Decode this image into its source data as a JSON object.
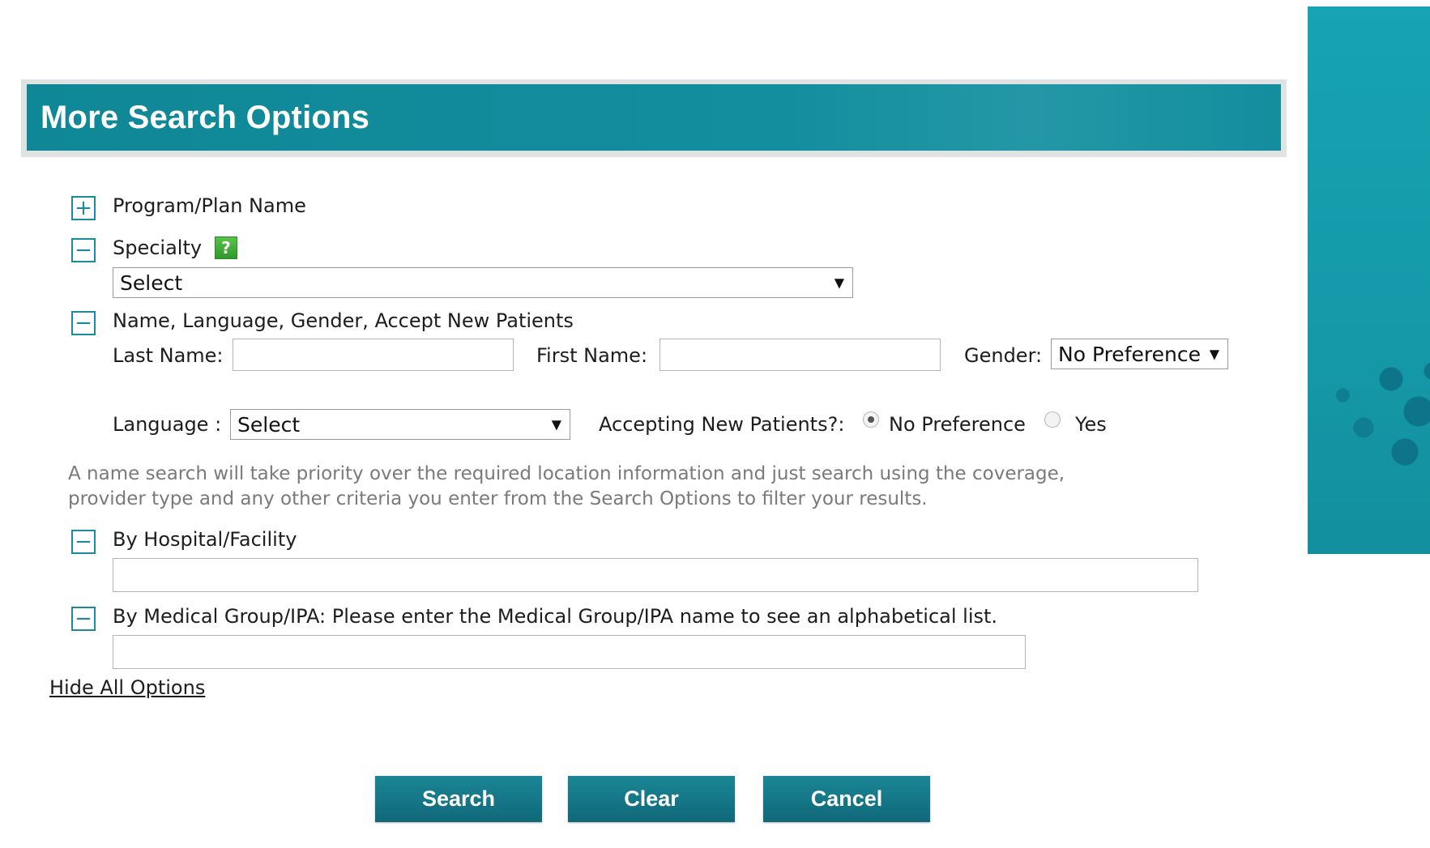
{
  "header": {
    "title": "More Search Options"
  },
  "sections": {
    "program": {
      "label": "Program/Plan Name",
      "toggle": "+"
    },
    "specialty": {
      "label": "Specialty",
      "toggle": "−",
      "help": "?",
      "select_value": "Select"
    },
    "name": {
      "label": "Name, Language, Gender, Accept New Patients",
      "toggle": "−",
      "last_name_label": "Last Name:",
      "last_name_value": "",
      "first_name_label": "First Name:",
      "first_name_value": "",
      "gender_label": "Gender:",
      "gender_value": "No Preference",
      "language_label": "Language :",
      "language_value": "Select",
      "accepting_label": "Accepting New Patients?:",
      "accepting_options": [
        "No Preference",
        "Yes"
      ],
      "accepting_selected": "No Preference"
    },
    "note": "A name search will take priority over the required location information and just search using the coverage, provider type and any other criteria you enter from the Search Options to filter your results.",
    "hospital": {
      "label": "By Hospital/Facility",
      "toggle": "−",
      "value": ""
    },
    "medical_group": {
      "label": "By Medical Group/IPA: Please enter the Medical Group/IPA name to see an alphabetical list.",
      "toggle": "−",
      "value": ""
    }
  },
  "links": {
    "hide_all": "Hide All Options"
  },
  "buttons": {
    "search": "Search",
    "clear": "Clear",
    "cancel": "Cancel"
  },
  "icons": {
    "select_arrow": "▼"
  },
  "colors": {
    "accent": "#138e9e",
    "button": "#0f6878",
    "help": "#3aa835"
  }
}
